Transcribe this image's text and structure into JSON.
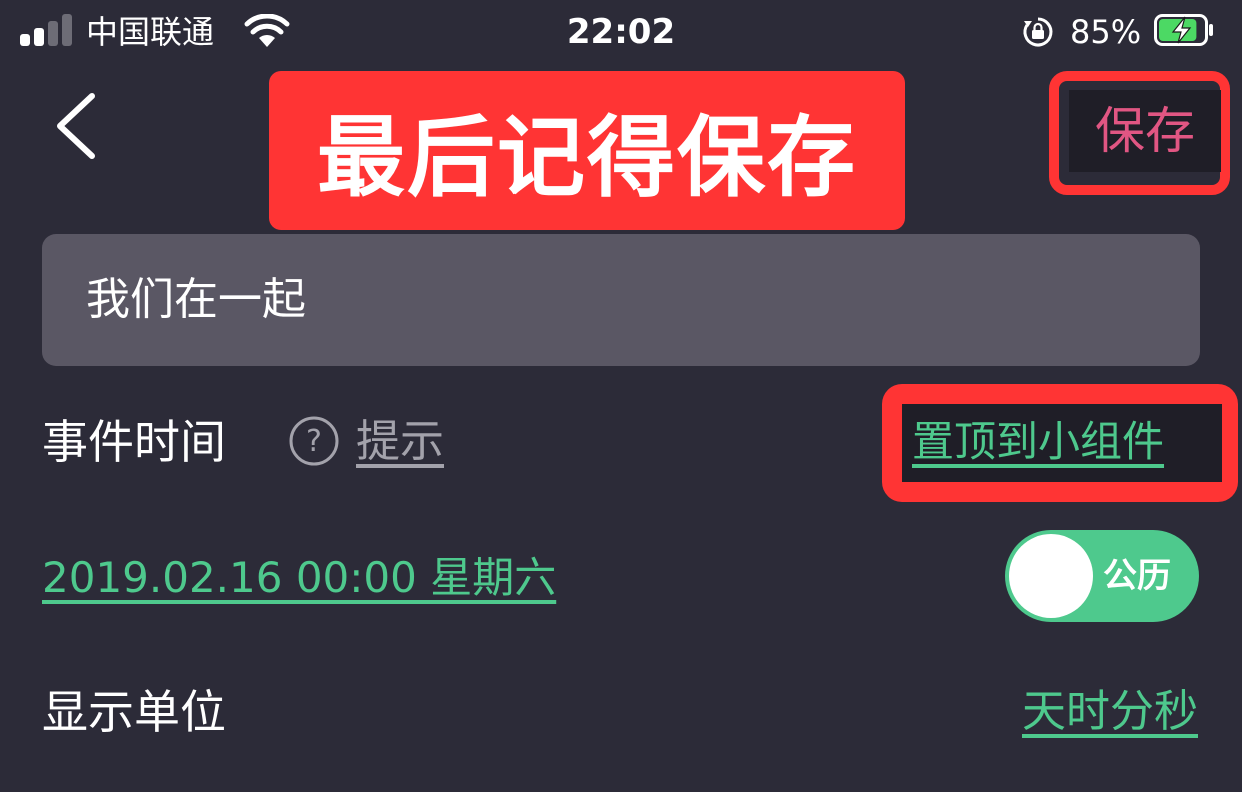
{
  "status_bar": {
    "carrier": "中国联通",
    "time": "22:02",
    "battery_percent": "85%",
    "signal_bars_active": 2,
    "signal_bars_total": 4,
    "battery_level": 0.85,
    "charging": true,
    "icons": [
      "signal-icon",
      "wifi-icon",
      "rotation-lock-icon",
      "battery-charging-icon"
    ]
  },
  "nav": {
    "back_icon": "chevron-left-icon",
    "annotation": "最后记得保存",
    "save_label": "保存"
  },
  "title_input": {
    "value": "我们在一起"
  },
  "event_time": {
    "label": "事件时间",
    "help_icon": "question-circle-icon",
    "hint_label": "提示",
    "widget_link": "置顶到小组件"
  },
  "date_row": {
    "date_text": "2019.02.16  00:00  星期六",
    "calendar_toggle_label": "公历",
    "calendar_toggle_on": true
  },
  "display_unit": {
    "label": "显示单位",
    "value": "天时分秒"
  },
  "colors": {
    "background": "#2c2b38",
    "accent_green": "#4ec98d",
    "save_pink": "#e15683",
    "annotation_red": "#ff3434",
    "input_bg": "#5a5764",
    "hint_gray": "#a3a2ab"
  }
}
